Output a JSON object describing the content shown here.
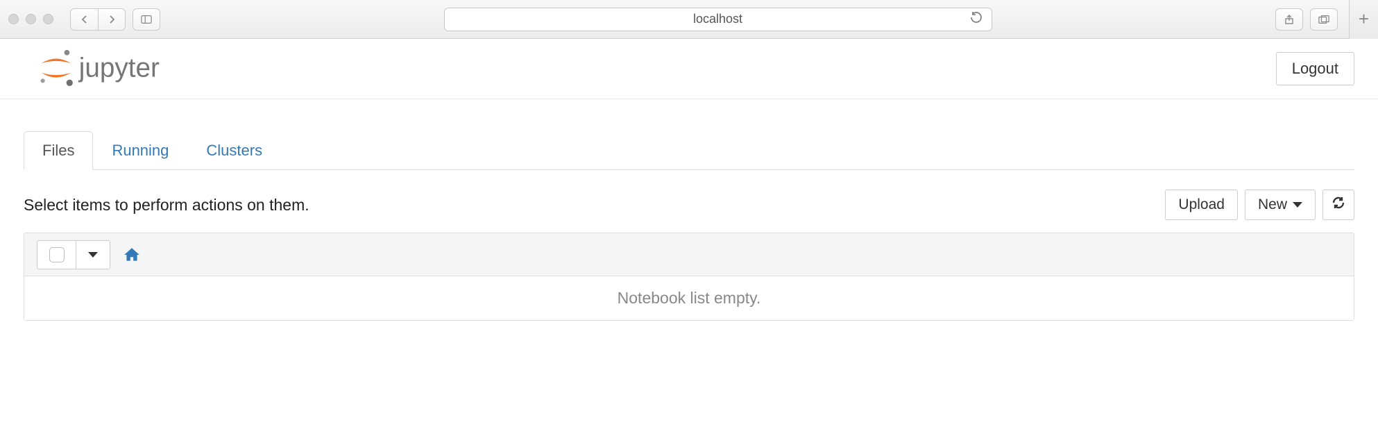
{
  "browser": {
    "address": "localhost"
  },
  "header": {
    "logout_label": "Logout"
  },
  "tabs": [
    {
      "label": "Files",
      "active": true
    },
    {
      "label": "Running",
      "active": false
    },
    {
      "label": "Clusters",
      "active": false
    }
  ],
  "actions": {
    "prompt": "Select items to perform actions on them.",
    "upload_label": "Upload",
    "new_label": "New"
  },
  "list": {
    "empty_message": "Notebook list empty."
  }
}
